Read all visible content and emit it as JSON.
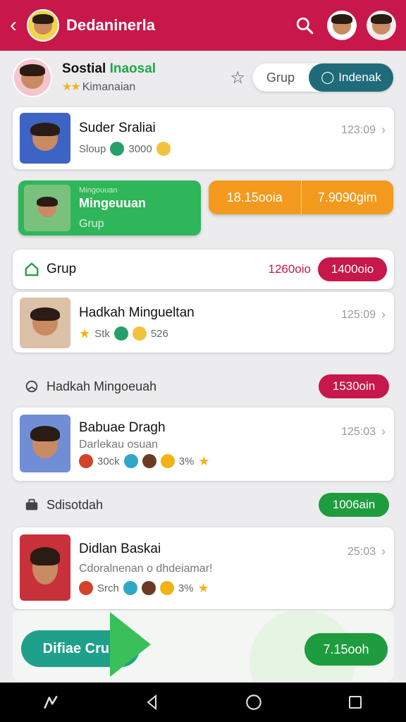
{
  "header": {
    "title": "Dedaninerla",
    "colors": {
      "bar": "#c8174a"
    }
  },
  "profile": {
    "name_part1": "Sostial",
    "name_part2": "Inaosal",
    "subtitle": "Kimanaian",
    "segment": {
      "left": "Grup",
      "right": "Indenak"
    }
  },
  "cards": {
    "first": {
      "title": "Suder Sraliai",
      "sub": "Sloup",
      "meta": "3000",
      "time": "123:09"
    },
    "green": {
      "small": "Mingouuan",
      "title": "Mingeuuan",
      "sub": "Grup"
    },
    "orange": {
      "left": "18.15ooia",
      "right": "7.9090gim"
    }
  },
  "grup": {
    "label": "Grup",
    "value": "1260oio",
    "pill": "1400oio"
  },
  "items": [
    {
      "title": "Hadkah Mingueltan",
      "sub": "",
      "meta_left": "Stk",
      "meta_right": "526",
      "time": "125:09"
    },
    {
      "title": "Babuae Dragh",
      "sub": "Darlekau osuan",
      "meta_left": "30ck",
      "meta_right": "3%",
      "time": "125:03"
    },
    {
      "title": "Didlan Baskai",
      "sub": "Cdoralnenan o dhdeiamar!",
      "meta_left": "Srch",
      "meta_right": "3%",
      "time": "25:03"
    }
  ],
  "sections": [
    {
      "label": "Hadkah Mingoeuah",
      "pill": "1530oin"
    },
    {
      "label": "Sdisotdah",
      "pill": "1006ain"
    }
  ],
  "bottom": {
    "button": "Difiae Crup",
    "pill": "7.15ooh"
  }
}
